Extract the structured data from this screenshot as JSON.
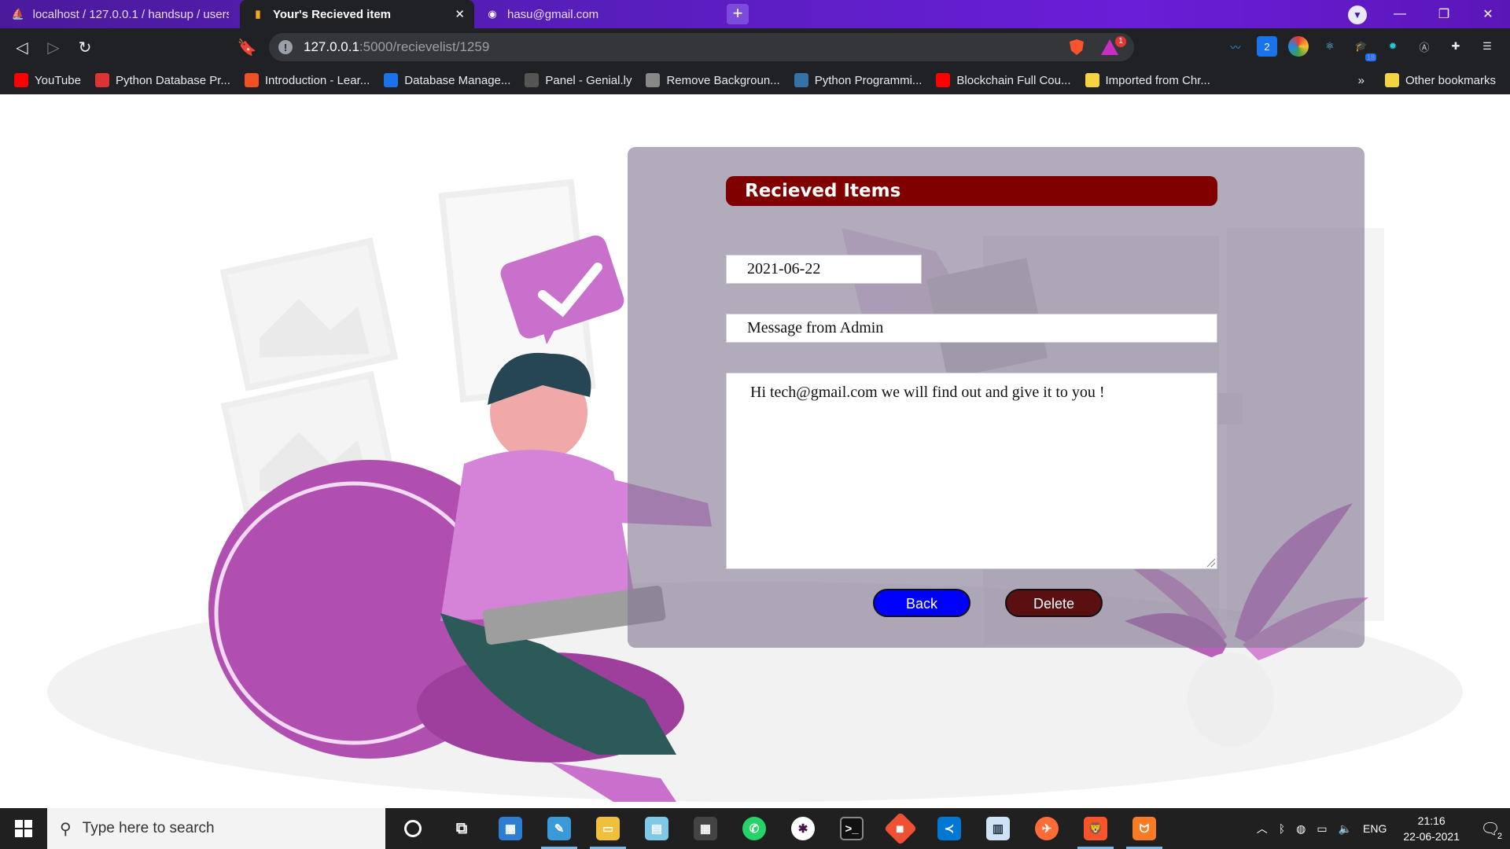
{
  "browser": {
    "tabs": [
      {
        "title": "localhost / 127.0.0.1 / handsup / users",
        "icon": "phpmyadmin-icon"
      },
      {
        "title": "Your's Recieved item",
        "icon": "chart-favicon-icon"
      },
      {
        "title": "hasu@gmail.com",
        "icon": "globe-icon"
      }
    ],
    "url_host": "127.0.0.1",
    "url_path": ":5000/recievelist/1259",
    "rewards_badge": "1",
    "ext_badge": "18",
    "ext_number": "2"
  },
  "bookmarks": [
    {
      "label": "YouTube",
      "icon": "youtube-icon",
      "color": "#ff0000"
    },
    {
      "label": "Python Database Pr...",
      "icon": "bookmark-favicon-icon",
      "color": "#d33"
    },
    {
      "label": "Introduction - Lear...",
      "icon": "microsoft-icon",
      "color": "#f25022"
    },
    {
      "label": "Database Manage...",
      "icon": "c-logo-icon",
      "color": "#1a73e8"
    },
    {
      "label": "Panel - Genial.ly",
      "icon": "genially-icon",
      "color": "#555"
    },
    {
      "label": "Remove Backgroun...",
      "icon": "layers-icon",
      "color": "#888"
    },
    {
      "label": "Python Programmi...",
      "icon": "python-icon",
      "color": "#3572a5"
    },
    {
      "label": "Blockchain Full Cou...",
      "icon": "youtube-icon",
      "color": "#ff0000"
    },
    {
      "label": "Imported from Chr...",
      "icon": "folder-icon",
      "color": "#f5d442"
    }
  ],
  "bookmarks_more": "»",
  "other_bookmarks": "Other bookmarks",
  "page": {
    "heading": "Recieved Items",
    "date": "2021-06-22",
    "subject": "Message from Admin",
    "message": "Hi tech@gmail.com we will find out and give it to you !",
    "back_label": "Back",
    "delete_label": "Delete"
  },
  "taskbar": {
    "search_placeholder": "Type here to search",
    "language": "ENG",
    "time": "21:16",
    "date": "22-06-2021",
    "notification_count": "2"
  },
  "colors": {
    "heading_bg": "#800000",
    "back_button": "#0000ff",
    "delete_button": "#5a1010",
    "titlebar": "#5a1ec0"
  }
}
